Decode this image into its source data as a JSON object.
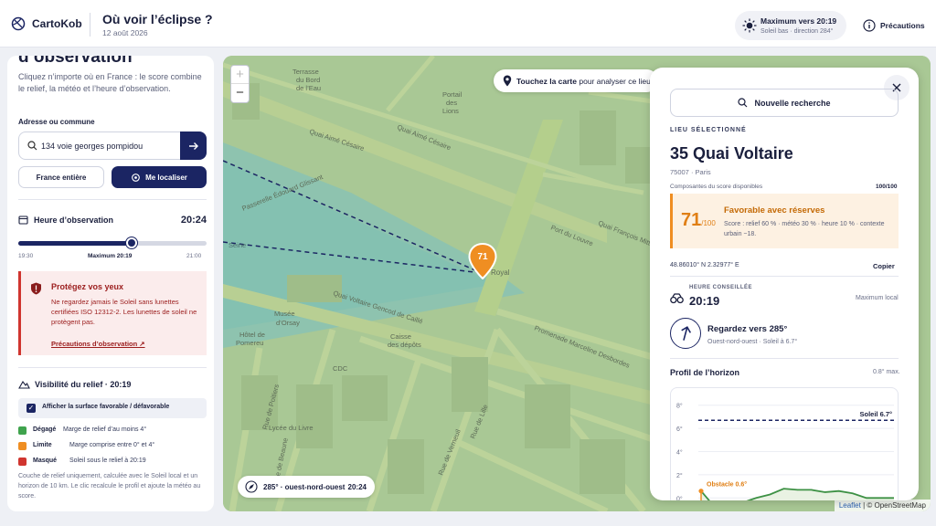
{
  "app": {
    "name": "CartoKob",
    "title": "Où voir l’éclipse ?",
    "date": "12 août 2026"
  },
  "header": {
    "max_title": "Maximum vers 20:19",
    "max_sub": "Soleil bas · direction 284°",
    "precautions": "Précautions"
  },
  "left": {
    "title": "d’observation",
    "intro": "Cliquez n’importe où en France : le score combine le relief, la météo et l’heure d’observation.",
    "address_label": "Adresse ou commune",
    "address_value": "134 voie georges pompidou",
    "btn_france": "France entière",
    "btn_locate": "Me localiser",
    "time_label": "Heure d’observation",
    "time_value": "20:24",
    "slider": {
      "min_label": "19:30",
      "max_point_label": "Maximum 20:19",
      "end_label": "21:00",
      "fraction": 0.6
    },
    "warning": {
      "title": "Protégez vos yeux",
      "body": "Ne regardez jamais le Soleil sans lunettes certifiées ISO 12312-2. Les lunettes de soleil ne protègent pas.",
      "link": "Précautions d’observation ↗"
    },
    "visibility_title": "Visibilité du relief · 20:19",
    "checkbox_label": "Afficher la surface favorable / défavorable",
    "legend": [
      {
        "name": "Dégagé",
        "desc": "Marge de relief d’au moins 4°",
        "color": "#3fa34d"
      },
      {
        "name": "Limite",
        "desc": "Marge comprise entre 0° et 4°",
        "color": "#ef8e22"
      },
      {
        "name": "Masqué",
        "desc": "Soleil sous le relief à 20:19",
        "color": "#d0352f"
      }
    ],
    "note": "Couche de relief uniquement, calculée avec le Soleil local et un horizon de 10 km. Le clic recalcule le profil et ajoute la météo au score."
  },
  "map": {
    "zoom_in": "+",
    "zoom_out": "−",
    "tap_bold": "Touchez la carte",
    "tap_rest": "pour analyser ce lieu",
    "marker_value": "71",
    "heading_dir": "285° · ouest-nord-ouest",
    "heading_time": "20:24",
    "attribution_leaflet": "Leaflet",
    "attribution_rest": "| © OpenStreetMap",
    "labels": {
      "terrasse": "Terrasse du Bord de l’Eau",
      "quai_cesaire": "Quai Aimé Césaire",
      "portail": "Portail des Lions",
      "quai_cesaire2": "Quai Aimé Césaire",
      "glissant": "Passerelle Édouard Glissant",
      "seine": "Seine",
      "pont": "Pont Royal",
      "quai_voltaire": "Quai Voltaire",
      "gencod": "Quai Voltaire Gencod de Caillé",
      "musee": "Musée d’Orsay",
      "pomereu": "Hôtel de Pomereu",
      "caisse": "Caisse des dépôts",
      "cdc": "CDC",
      "lille": "Rue de Lille",
      "bac": "Rue du Bac",
      "verneuil": "Rue de Verneuil",
      "poitiers": "Rue de Poitiers",
      "beaune": "Rue de Beaune",
      "promenade": "Promenade Marceline Desbordes",
      "quai_mitterrand": "Quai François Mitterrand",
      "louvre": "Port du Louvre",
      "universite": "Rue de l’Université",
      "lycee": "Lycée du Livre"
    }
  },
  "panel": {
    "new_search": "Nouvelle recherche",
    "caption": "LIEU SÉLECTIONNÉ",
    "place": "35 Quai Voltaire",
    "postcode": "75007 · Paris",
    "components_label": "Composantes du score disponibles",
    "components_value": "100/100",
    "score": "71",
    "score_max": "/100",
    "score_label": "Favorable avec réserves",
    "score_desc": "Score : relief 60 % · météo 30 % · heure 10 % · contexte urbain −18.",
    "coords": "48.86010° N   2.32977° E",
    "copy": "Copier",
    "best_caption": "HEURE CONSEILLÉE",
    "best_time": "20:19",
    "best_right": "Maximum local",
    "direction_title": "Regardez vers 285°",
    "direction_sub": "Ouest-nord-ouest · Soleil à 6.7°",
    "direction_deg": 285,
    "profile_title": "Profil de l’horizon",
    "profile_max": "0.8° max.",
    "close": "×"
  },
  "chart_data": {
    "type": "line",
    "yticks": [
      "8°",
      "6°",
      "4°",
      "2°",
      "0°"
    ],
    "ylim": [
      -1,
      9
    ],
    "series": [
      {
        "name": "Soleil 6.7°",
        "values": [
          6.7,
          6.7,
          6.7,
          6.7,
          6.7,
          6.7,
          6.7,
          6.7,
          6.7,
          6.7
        ]
      },
      {
        "name": "Obstacle 0.6°",
        "values": [
          0.6,
          -0.8,
          -1.2,
          -0.4,
          0.0,
          0.3,
          0.8,
          0.7,
          0.7,
          0.5,
          0.6,
          0.4,
          0.0,
          0.0,
          0.0
        ]
      }
    ],
    "sun_label": "Soleil 6.7°",
    "obstacle_label": "Obstacle 0.6°"
  }
}
